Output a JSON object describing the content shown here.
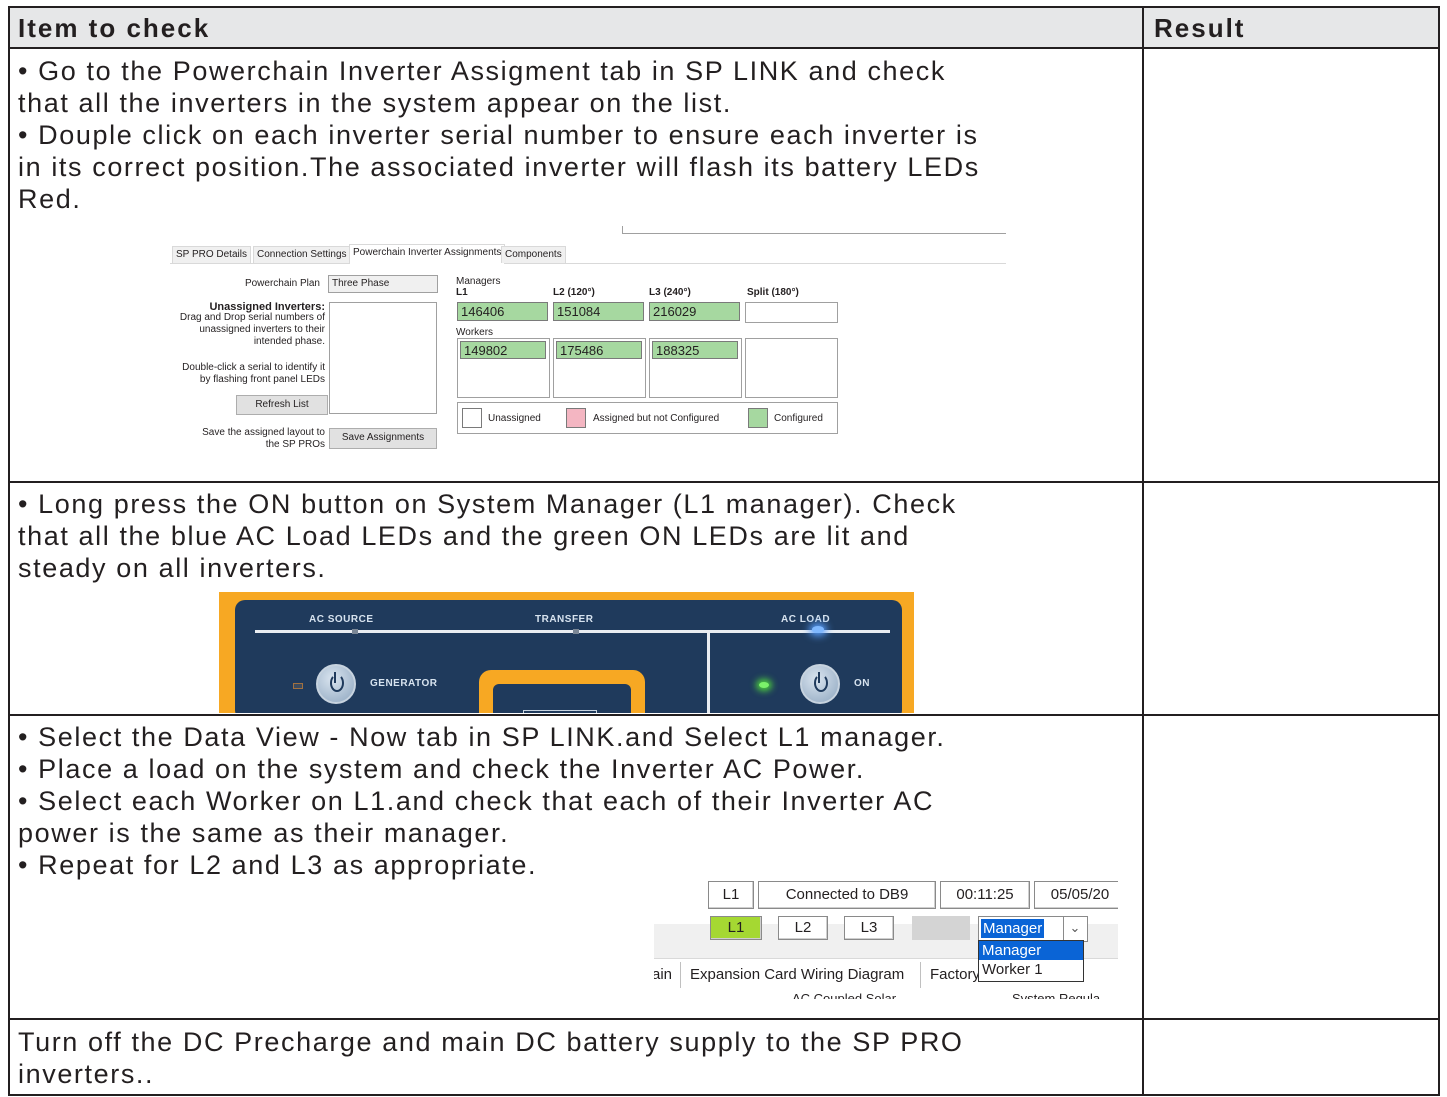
{
  "header": {
    "col1": "Item to check",
    "col2": "Result"
  },
  "rows": [
    {
      "lines": [
        "• Go to the Powerchain Inverter Assigment tab in SP LINK and check",
        "that all the inverters in the system appear on the list.",
        "• Douple click on each inverter serial number to ensure each inverter is",
        "in its correct position.The associated inverter will flash its battery LEDs",
        "Red."
      ]
    },
    {
      "lines": [
        "• Long press the ON button on System Manager (L1 manager). Check",
        "that all the blue AC Load LEDs and the green ON LEDs are lit and",
        "steady on all inverters."
      ]
    },
    {
      "lines": [
        "• Select the Data View - Now tab in SP LINK.and Select L1 manager.",
        "• Place a load on the system and check the Inverter AC Power.",
        "• Select each Worker on L1.and check that each of their Inverter AC",
        "power is the same as their manager.",
        "• Repeat for L2 and L3 as appropriate."
      ]
    },
    {
      "lines": [
        "Turn off the DC Precharge and main DC battery supply to the SP PRO",
        "inverters.."
      ]
    }
  ],
  "powerchain_screenshot": {
    "tabs": [
      "SP PRO Details",
      "Connection Settings",
      "Powerchain Inverter Assignments",
      "Components"
    ],
    "plan_label": "Powerchain Plan",
    "plan_value": "Three Phase",
    "unassigned_title": "Unassigned Inverters:",
    "unassigned_desc": [
      "Drag and Drop serial numbers of",
      "unassigned inverters to their",
      "intended phase."
    ],
    "identify_desc": [
      "Double-click a serial to identify it",
      "by flashing front panel LEDs"
    ],
    "refresh_button": "Refresh List",
    "save_desc": [
      "Save the assigned layout to",
      "the SP PROs"
    ],
    "save_button": "Save Assignments",
    "managers_label": "Managers",
    "phases": [
      "L1",
      "L2 (120°)",
      "L3 (240°)",
      "Split (180°)"
    ],
    "managers": [
      "146406",
      "151084",
      "216029",
      ""
    ],
    "workers_label": "Workers",
    "workers": [
      "149802",
      "175486",
      "188325",
      ""
    ],
    "legend": [
      "Unassigned",
      "Assigned but not Configured",
      "Configured"
    ],
    "colors": {
      "configured": "#a6d8a0",
      "not_configured": "#f4b6c2",
      "unassigned": "#ffffff"
    }
  },
  "front_panel_screenshot": {
    "labels": [
      "AC SOURCE",
      "TRANSFER",
      "AC LOAD",
      "GENERATOR",
      "ON"
    ],
    "colors": {
      "panel": "#1f3a5c",
      "frame": "#f7a823",
      "on_led": "#7cf26a",
      "load_led": "#7fb8ff"
    }
  },
  "dataview_screenshot": {
    "status": [
      "L1",
      "Connected to DB9",
      "00:11:25",
      "05/05/20"
    ],
    "phase_buttons": [
      "L1",
      "L2",
      "L3"
    ],
    "selected_phase": "L1",
    "dropdown_value": "Manager",
    "dropdown_options": [
      "Manager",
      "Worker 1"
    ],
    "menu_items": [
      "ain",
      "Expansion Card Wiring Diagram",
      "Factory"
    ],
    "clipped_labels": [
      "AC Coupled Solar",
      "System Regula"
    ],
    "colors": {
      "selected_phase": "#a5d832",
      "highlight": "#0a64d6"
    }
  }
}
